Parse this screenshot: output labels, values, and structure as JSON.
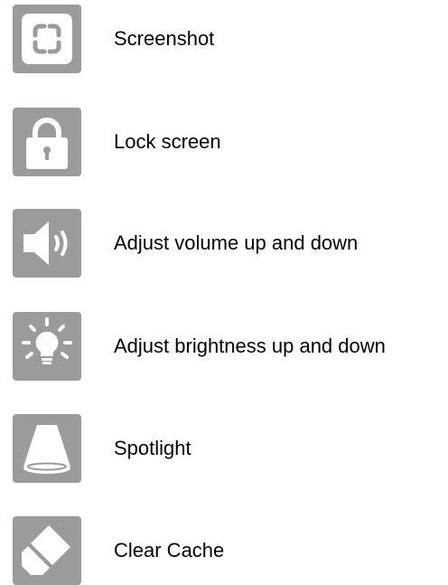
{
  "items": [
    {
      "icon": "screenshot-icon",
      "label": "Screenshot"
    },
    {
      "icon": "lock-icon",
      "label": "Lock screen"
    },
    {
      "icon": "volume-icon",
      "label": "Adjust volume up and down"
    },
    {
      "icon": "brightness-icon",
      "label": "Adjust brightness up and down"
    },
    {
      "icon": "spotlight-icon",
      "label": "Spotlight"
    },
    {
      "icon": "eraser-icon",
      "label": "Clear Cache"
    }
  ],
  "colors": {
    "icon_tile": "#9b9b9b",
    "icon_glyph": "#ffffff",
    "text": "#000000"
  }
}
